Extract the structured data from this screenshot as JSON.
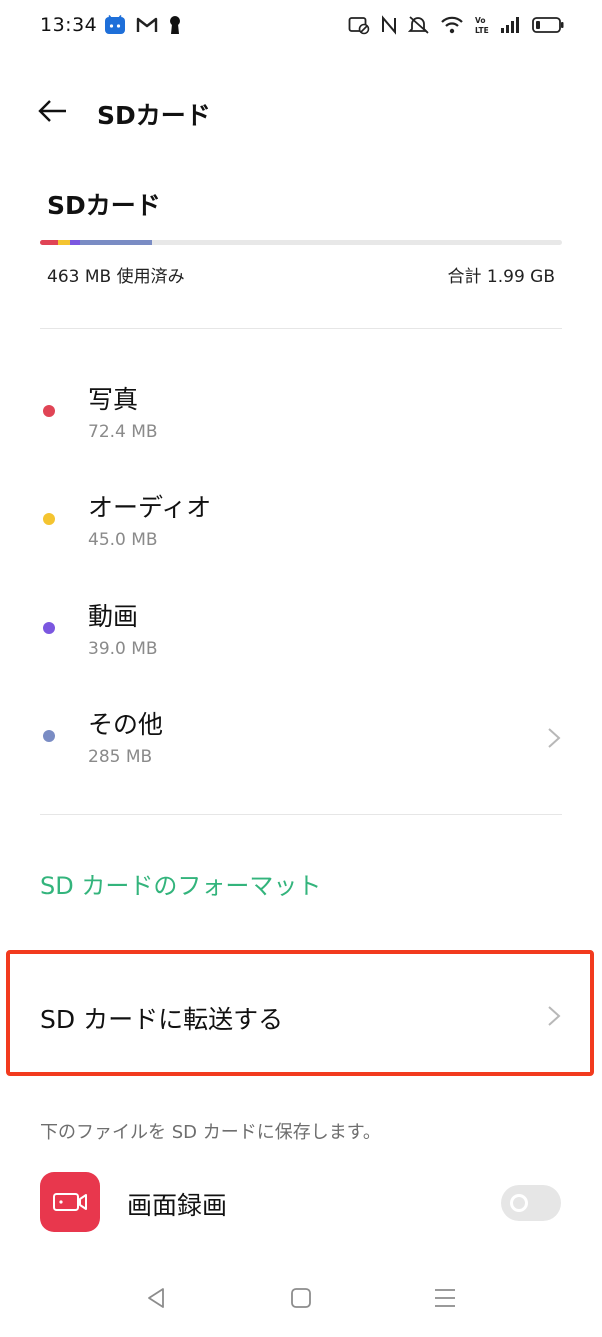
{
  "status_bar": {
    "time": "13:34",
    "left_icons": [
      "android-icon",
      "gmail-icon",
      "keyhole-icon"
    ],
    "right_icons": [
      "nfc-card-icon",
      "nfc-icon",
      "mute-icon",
      "wifi-icon",
      "volte-icon",
      "signal-icon",
      "battery-icon"
    ]
  },
  "header": {
    "title": "SDカード",
    "back_icon": "arrow-left-icon"
  },
  "storage": {
    "title": "SDカード",
    "used_label": "463 MB 使用済み",
    "total_label": "合計 1.99 GB",
    "used_fraction": 0.227,
    "segments": [
      {
        "name": "写真",
        "fraction": 0.035,
        "color": "#e04455"
      },
      {
        "name": "オーディオ",
        "fraction": 0.022,
        "color": "#f4c430"
      },
      {
        "name": "動画",
        "fraction": 0.019,
        "color": "#7b57e0"
      },
      {
        "name": "その他",
        "fraction": 0.139,
        "color": "#7a8cc4"
      }
    ]
  },
  "categories": [
    {
      "name": "写真",
      "size": "72.4 MB",
      "color": "#e04455"
    },
    {
      "name": "オーディオ",
      "size": "45.0 MB",
      "color": "#f4c430"
    },
    {
      "name": "動画",
      "size": "39.0 MB",
      "color": "#7b57e0"
    },
    {
      "name": "その他",
      "size": "285 MB",
      "color": "#7a8cc4"
    }
  ],
  "actions": {
    "format_label": "SD カードのフォーマット",
    "transfer_label": "SD カードに転送する"
  },
  "save_section": {
    "caption": "下のファイルを SD カードに保存します。",
    "items": [
      {
        "label": "画面録画",
        "icon": "screen-record-icon",
        "enabled": false
      }
    ]
  },
  "colors": {
    "accent_green": "#33b47c",
    "highlight_red": "#f23a1e",
    "app_icon_red": "#e8374d"
  },
  "navbar": {
    "icons": [
      "back-triangle-icon",
      "home-square-icon",
      "recents-menu-icon"
    ]
  }
}
